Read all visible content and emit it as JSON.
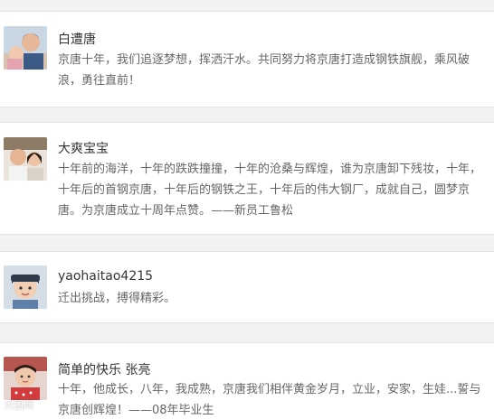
{
  "comments": [
    {
      "name": "白遭唐",
      "text": "京唐十年，我们追逐梦想，挥洒汗水。共同努力将京唐打造成钢铁旗舰，乘风破浪，勇往直前！",
      "avatar_icon": "user-avatar-child-photo"
    },
    {
      "name": "大爽宝宝",
      "text": "十年前的海洋，十年的跌跌撞撞，十年的沧桑与辉煌，谁为京唐卸下残妆，十年，十年后的首钢京唐，十年后的钢铁之王，十年后的伟大钢厂，成就自己，圆梦京唐。为京唐成立十周年点赞。——新员工鲁松",
      "avatar_icon": "user-avatar-couple-photo"
    },
    {
      "name": "yaohaitao4215",
      "text": "迁出挑战，搏得精彩。",
      "avatar_icon": "user-avatar-baby-photo"
    },
    {
      "name": "简单的快乐 张亮",
      "text": "十年，他成长，八年，我成熟，京唐我们相伴黄金岁月，立业，安家，生娃...誓与京唐创辉煌！——08年毕业生",
      "avatar_icon": "user-avatar-girl-photo"
    }
  ],
  "watermark": "大图网"
}
